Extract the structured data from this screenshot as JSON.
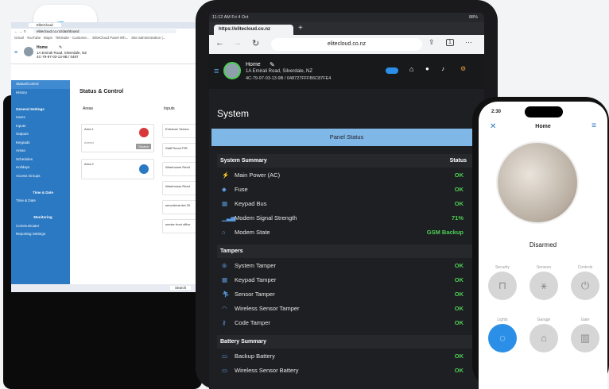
{
  "laptop": {
    "tab_title": "EliteCloud",
    "url": "elitecloud.co.nz/dashboard",
    "bookmarks": [
      "Gmail",
      "YouTube",
      "Maps",
      "TekSuite - Custome...",
      "EliteCloud Panel Wh...",
      "Site administration |..."
    ],
    "home_title": "Home",
    "address": "1A Emirali Road, Silverdale, NZ",
    "device_id": "4C-79-97-03-13-9B / 0487",
    "page_title": "Status & Control",
    "areas_label": "Areas",
    "inputs_label": "Inputs",
    "area1": "Area 1",
    "area1_status": "Armed",
    "area1_action": "Disarm",
    "area2": "Area 2",
    "inputs": [
      "Entrance Sensor",
      "Staff Room PIR",
      "Warehouse Reed",
      "Warehouse Reed",
      "serverbeat det 25",
      "smoke front office"
    ],
    "sidebar": [
      {
        "label": "Status/Control"
      },
      {
        "label": "History"
      },
      {
        "label": ""
      },
      {
        "label": "General Settings"
      },
      {
        "label": "Users"
      },
      {
        "label": "Inputs"
      },
      {
        "label": "Outputs"
      },
      {
        "label": "Keypads"
      },
      {
        "label": "Areas"
      },
      {
        "label": "Schedules"
      },
      {
        "label": "Holidays"
      },
      {
        "label": "Access Groups"
      },
      {
        "label": ""
      },
      {
        "label": "Time & Date"
      },
      {
        "label": "Time & Date"
      },
      {
        "label": ""
      },
      {
        "label": "Monitoring"
      },
      {
        "label": "Communicator"
      },
      {
        "label": "Reporting Settings"
      }
    ],
    "search": "Search"
  },
  "tablet": {
    "time": "11:12 AM  Fri 4 Oct",
    "battery": "88%",
    "tab_url": "https://elitecloud.co.nz",
    "address_bar": "elitecloud.co.nz",
    "home_title": "Home",
    "address": "1A Emirali Road, Silverdale, NZ",
    "device_id": "4C-79-97-03-13-9B / 048727FFFB6C87FE4",
    "system_title": "System",
    "panel_status": "Panel Status",
    "system_summary": "System Summary",
    "status_header": "Status",
    "summary_rows": [
      {
        "label": "Main Power (AC)",
        "value": "OK",
        "icon": "bolt-icon"
      },
      {
        "label": "Fuse",
        "value": "OK",
        "icon": "shield-icon"
      },
      {
        "label": "Keypad Bus",
        "value": "OK",
        "icon": "keypad-icon"
      },
      {
        "label": "Modem Signal Strength",
        "value": "71%",
        "icon": "signal-icon"
      },
      {
        "label": "Modem State",
        "value": "GSM Backup",
        "icon": "router-icon"
      }
    ],
    "tampers_title": "Tampers",
    "tamper_rows": [
      {
        "label": "System Tamper",
        "value": "OK"
      },
      {
        "label": "Keypad Tamper",
        "value": "OK"
      },
      {
        "label": "Sensor Tamper",
        "value": "OK"
      },
      {
        "label": "Wireless Sensor Tamper",
        "value": "OK"
      },
      {
        "label": "Code Tamper",
        "value": "OK"
      }
    ],
    "battery_title": "Battery Summary",
    "battery_rows": [
      {
        "label": "Backup Battery",
        "value": "OK"
      },
      {
        "label": "Wireless Sensor Battery",
        "value": "OK"
      }
    ]
  },
  "phone": {
    "time": "2:30",
    "title": "Home",
    "state": "Disarmed",
    "controls": [
      "Security",
      "Sensors",
      "Controls",
      "Lights",
      "Garage",
      "Gate"
    ]
  },
  "colors": {
    "accent": "#2b79c2",
    "ok": "#4ccf55",
    "panel": "#7fb8e6",
    "active": "#2b8fe8"
  }
}
